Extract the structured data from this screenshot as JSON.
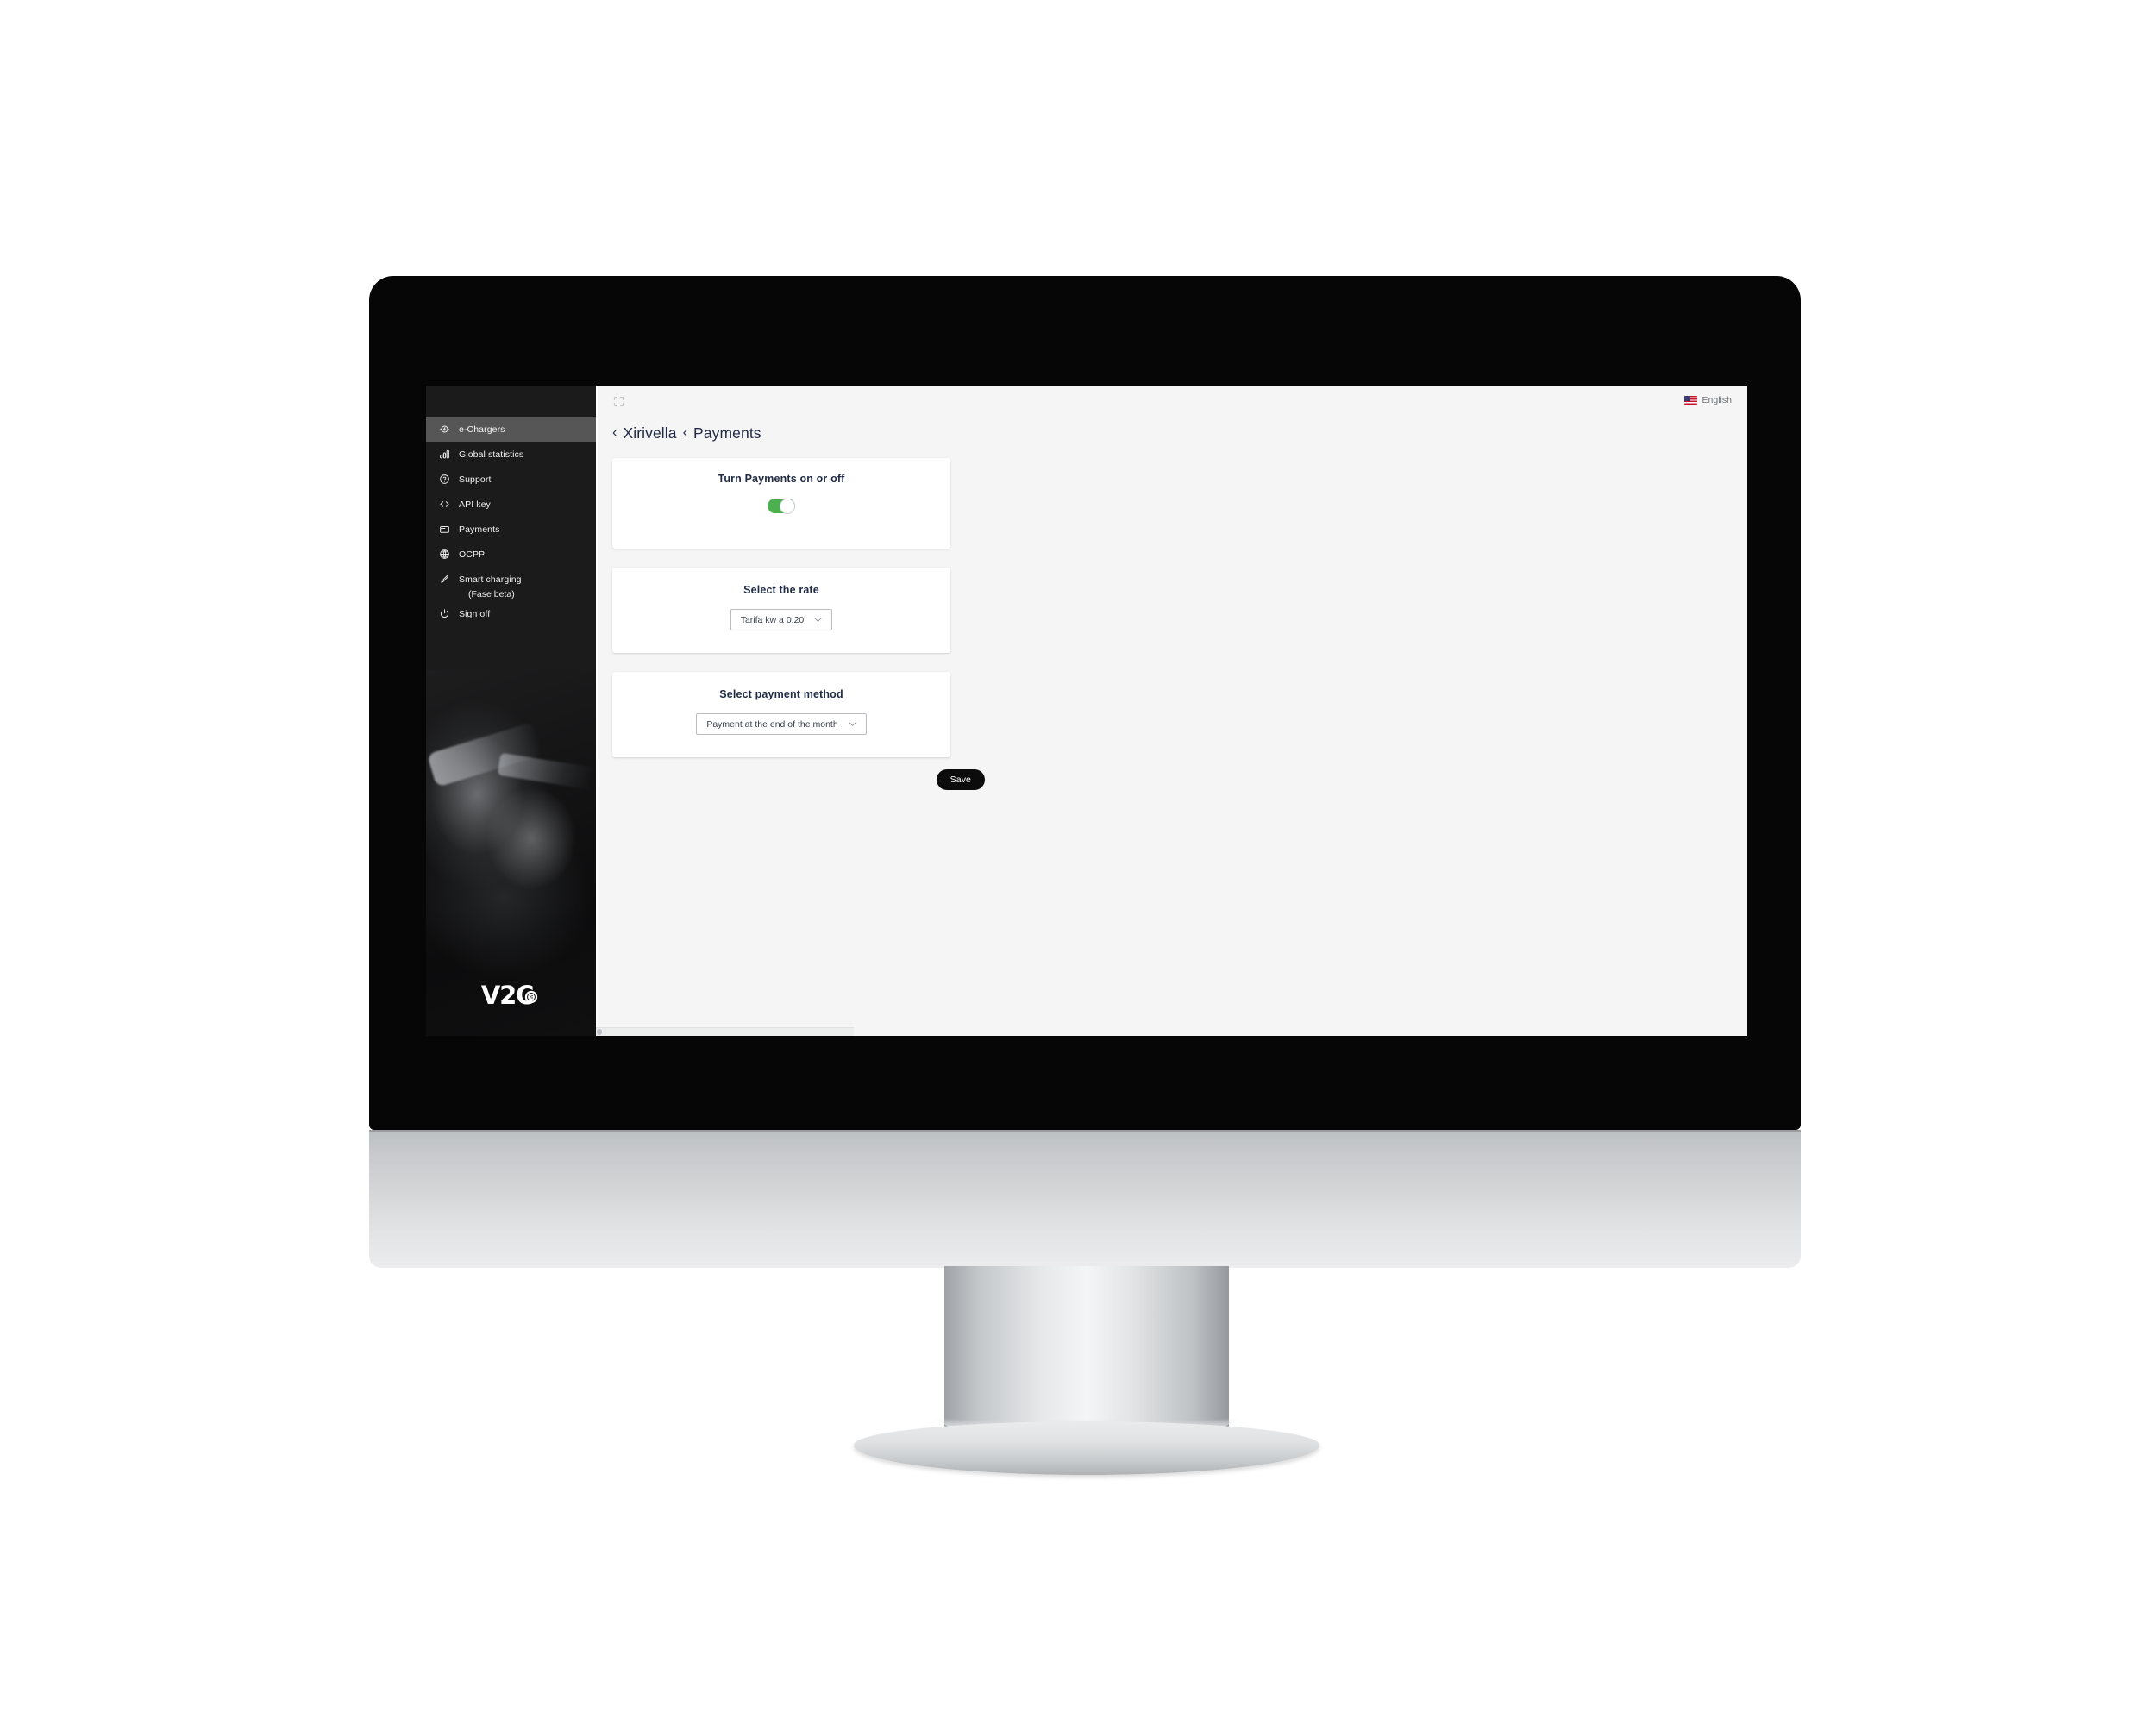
{
  "app": {
    "brand": "V2C",
    "brand_icon": "v2c-logo"
  },
  "sidebar": {
    "items": [
      {
        "label": "e-Chargers",
        "icon": "ev-charger-icon",
        "active": true
      },
      {
        "label": "Global statistics",
        "icon": "bar-chart-icon",
        "active": false
      },
      {
        "label": "Support",
        "icon": "question-circle-icon",
        "active": false
      },
      {
        "label": "API key",
        "icon": "code-brackets-icon",
        "active": false
      },
      {
        "label": "Payments",
        "icon": "wallet-icon",
        "active": false
      },
      {
        "label": "OCPP",
        "icon": "globe-icon",
        "active": false
      },
      {
        "label": "Smart charging",
        "icon": "pencil-icon",
        "active": false
      },
      {
        "label": "Sign off",
        "icon": "power-icon",
        "active": false
      }
    ],
    "smart_charging_sublabel": "(Fase beta)"
  },
  "topbar": {
    "expand_icon": "fullscreen-icon",
    "language": "English",
    "language_flag": "us-flag-icon"
  },
  "breadcrumb": {
    "chevron": "‹",
    "parent": "Xirivella",
    "current": "Payments"
  },
  "cards": [
    {
      "title": "Turn Payments on or off",
      "control": "toggle",
      "toggle_on": true,
      "toggle_color": "#4caf50"
    },
    {
      "title": "Select the rate",
      "control": "select",
      "value": "Tarifa kw a 0.20",
      "chevron_icon": "chevron-down-icon"
    },
    {
      "title": "Select payment method",
      "control": "select",
      "value": "Payment at the end of the month",
      "chevron_icon": "chevron-down-icon"
    }
  ],
  "actions": {
    "save_label": "Save"
  },
  "colors": {
    "accent_green": "#4caf50",
    "sidebar_bg": "#1b1b1b",
    "content_bg": "#f5f5f6",
    "text_dark": "#1f2a44",
    "button_bg": "#0c0c0c"
  }
}
